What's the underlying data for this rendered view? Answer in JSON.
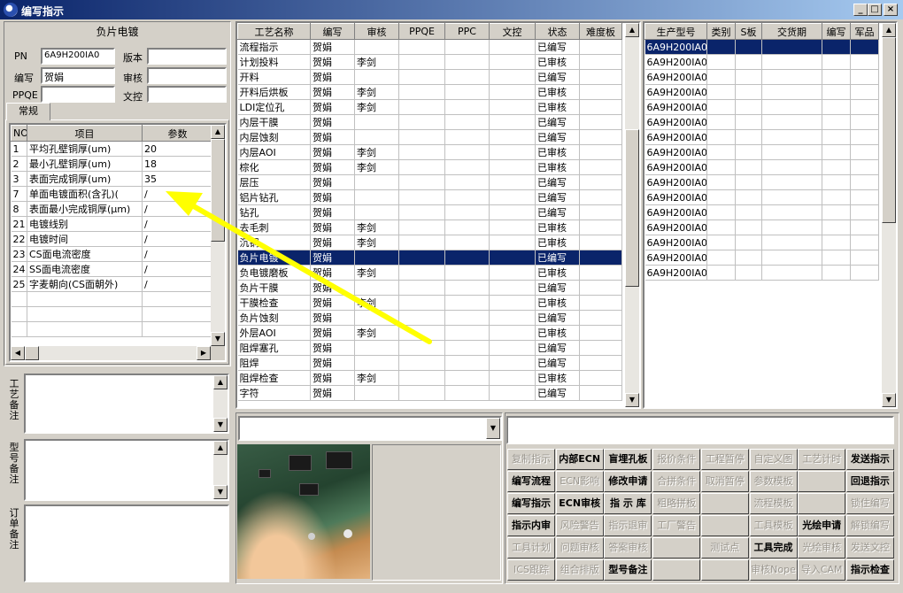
{
  "window": {
    "title": "编写指示",
    "min": "_",
    "max": "□",
    "close": "×"
  },
  "header_panel": {
    "title": "负片电镀",
    "pn_label": "PN",
    "pn_value": "6A9H200IA0",
    "version_label": "版本",
    "version_value": "",
    "writer_label": "编写",
    "writer_value": "贺娟",
    "audit_label": "审核",
    "audit_value": "",
    "ppqe_label": "PPQE",
    "ppqe_value": "",
    "doc_label": "文控",
    "doc_value": ""
  },
  "tabs": {
    "general": "常规"
  },
  "params_table": {
    "headers": [
      "NO",
      "项目",
      "参数"
    ],
    "rows": [
      [
        "1",
        "平均孔壁铜厚(um)",
        "20"
      ],
      [
        "2",
        "最小孔壁铜厚(um)",
        "18"
      ],
      [
        "3",
        "表面完成铜厚(um)",
        "35"
      ],
      [
        "7",
        "单面电镀面积(含孔)(",
        "/"
      ],
      [
        "8",
        "表面最小完成铜厚(μm)",
        "/"
      ],
      [
        "21",
        "电镀线别",
        "/"
      ],
      [
        "22",
        "电镀时间",
        "/"
      ],
      [
        "23",
        "CS面电流密度",
        "/"
      ],
      [
        "24",
        "SS面电流密度",
        "/"
      ],
      [
        "25",
        "字麦朝向(CS面朝外)",
        "/"
      ]
    ]
  },
  "notes": {
    "process_label": "工艺备注",
    "model_label": "型号备注",
    "order_label": "订单备注"
  },
  "process_table": {
    "headers": [
      "工艺名称",
      "编写",
      "审核",
      "PPQE",
      "PPC",
      "文控",
      "状态",
      "难度板"
    ],
    "rows": [
      [
        "流程指示",
        "贺娟",
        "",
        "",
        "",
        "",
        "已编写",
        ""
      ],
      [
        "计划投料",
        "贺娟",
        "李剑",
        "",
        "",
        "",
        "已审核",
        ""
      ],
      [
        "开料",
        "贺娟",
        "",
        "",
        "",
        "",
        "已编写",
        ""
      ],
      [
        "开料后烘板",
        "贺娟",
        "李剑",
        "",
        "",
        "",
        "已审核",
        ""
      ],
      [
        "LDI定位孔",
        "贺娟",
        "李剑",
        "",
        "",
        "",
        "已审核",
        ""
      ],
      [
        "内层干膜",
        "贺娟",
        "",
        "",
        "",
        "",
        "已编写",
        ""
      ],
      [
        "内层蚀刻",
        "贺娟",
        "",
        "",
        "",
        "",
        "已编写",
        ""
      ],
      [
        "内层AOI",
        "贺娟",
        "李剑",
        "",
        "",
        "",
        "已审核",
        ""
      ],
      [
        "棕化",
        "贺娟",
        "李剑",
        "",
        "",
        "",
        "已审核",
        ""
      ],
      [
        "层压",
        "贺娟",
        "",
        "",
        "",
        "",
        "已编写",
        ""
      ],
      [
        "铝片钻孔",
        "贺娟",
        "",
        "",
        "",
        "",
        "已编写",
        ""
      ],
      [
        "钻孔",
        "贺娟",
        "",
        "",
        "",
        "",
        "已编写",
        ""
      ],
      [
        "去毛刺",
        "贺娟",
        "李剑",
        "",
        "",
        "",
        "已审核",
        ""
      ],
      [
        "沉铜",
        "贺娟",
        "李剑",
        "",
        "",
        "",
        "已审核",
        ""
      ],
      [
        "负片电镀",
        "贺娟",
        "",
        "",
        "",
        "",
        "已编写",
        ""
      ],
      [
        "负电镀磨板",
        "贺娟",
        "李剑",
        "",
        "",
        "",
        "已审核",
        ""
      ],
      [
        "负片干膜",
        "贺娟",
        "",
        "",
        "",
        "",
        "已编写",
        ""
      ],
      [
        "干膜检查",
        "贺娟",
        "李剑",
        "",
        "",
        "",
        "已审核",
        ""
      ],
      [
        "负片蚀刻",
        "贺娟",
        "",
        "",
        "",
        "",
        "已编写",
        ""
      ],
      [
        "外层AOI",
        "贺娟",
        "李剑",
        "",
        "",
        "",
        "已审核",
        ""
      ],
      [
        "阻焊塞孔",
        "贺娟",
        "",
        "",
        "",
        "",
        "已编写",
        ""
      ],
      [
        "阻焊",
        "贺娟",
        "",
        "",
        "",
        "",
        "已编写",
        ""
      ],
      [
        "阻焊检查",
        "贺娟",
        "李剑",
        "",
        "",
        "",
        "已审核",
        ""
      ],
      [
        "字符",
        "贺娟",
        "",
        "",
        "",
        "",
        "已编写",
        ""
      ]
    ],
    "selected_index": 14
  },
  "model_table": {
    "headers": [
      "生产型号",
      "类别",
      "S板",
      "交货期",
      "编写",
      "军品"
    ],
    "rows": [
      "6A9H200IA0",
      "6A9H200IA0",
      "6A9H200IA0",
      "6A9H200IA0",
      "6A9H200IA0",
      "6A9H200IA0",
      "6A9H200IA0",
      "6A9H200IA0",
      "6A9H200IA0",
      "6A9H200IA0",
      "6A9H200IA0",
      "6A9H200IA0",
      "6A9H200IA0",
      "6A9H200IA0",
      "6A9H200IA0",
      "6A9H200IA0"
    ],
    "selected_index": 0
  },
  "buttons": [
    [
      {
        "label": "复制指示",
        "enabled": false
      },
      {
        "label": "内部ECN",
        "enabled": true
      },
      {
        "label": "盲埋孔板",
        "enabled": true
      },
      {
        "label": "报价条件",
        "enabled": false
      },
      {
        "label": "工程暂停",
        "enabled": false
      },
      {
        "label": "自定义图",
        "enabled": false
      },
      {
        "label": "工艺计时",
        "enabled": false
      },
      {
        "label": "发送指示",
        "enabled": true
      }
    ],
    [
      {
        "label": "编写流程",
        "enabled": true
      },
      {
        "label": "ECN影响",
        "enabled": false
      },
      {
        "label": "修改申请",
        "enabled": true
      },
      {
        "label": "合拼条件",
        "enabled": false
      },
      {
        "label": "取消暂停",
        "enabled": false
      },
      {
        "label": "参数模板",
        "enabled": false
      },
      {
        "label": "",
        "enabled": false
      },
      {
        "label": "回退指示",
        "enabled": true
      }
    ],
    [
      {
        "label": "编写指示",
        "enabled": true
      },
      {
        "label": "ECN审核",
        "enabled": true
      },
      {
        "label": "指 示 库",
        "enabled": true
      },
      {
        "label": "粗略拼板",
        "enabled": false
      },
      {
        "label": "",
        "enabled": false
      },
      {
        "label": "流程模板",
        "enabled": false
      },
      {
        "label": "",
        "enabled": false
      },
      {
        "label": "锁住编写",
        "enabled": false
      }
    ],
    [
      {
        "label": "指示内审",
        "enabled": true
      },
      {
        "label": "风险警告",
        "enabled": false
      },
      {
        "label": "指示退审",
        "enabled": false
      },
      {
        "label": "工厂警告",
        "enabled": false
      },
      {
        "label": "",
        "enabled": false
      },
      {
        "label": "工具模板",
        "enabled": false
      },
      {
        "label": "光绘申请",
        "enabled": true
      },
      {
        "label": "解锁编写",
        "enabled": false
      }
    ],
    [
      {
        "label": "工具计划",
        "enabled": false
      },
      {
        "label": "问题审核",
        "enabled": false
      },
      {
        "label": "答案审核",
        "enabled": false
      },
      {
        "label": "",
        "enabled": false
      },
      {
        "label": "测试点",
        "enabled": false
      },
      {
        "label": "工具完成",
        "enabled": true
      },
      {
        "label": "光绘审核",
        "enabled": false
      },
      {
        "label": "发送文控",
        "enabled": false
      }
    ],
    [
      {
        "label": "ICS跟踪",
        "enabled": false
      },
      {
        "label": "组合排版",
        "enabled": false
      },
      {
        "label": "型号备注",
        "enabled": true
      },
      {
        "label": "",
        "enabled": false
      },
      {
        "label": "",
        "enabled": false
      },
      {
        "label": "审核Nope",
        "enabled": false
      },
      {
        "label": "导入CAM",
        "enabled": false
      },
      {
        "label": "指示检查",
        "enabled": true
      }
    ]
  ],
  "colors": {
    "titlebar": "#0a246a",
    "selection": "#0a246a",
    "annotation_arrow": "#ffff00"
  },
  "icons": {
    "app": "app-logo-icon",
    "photo": "pcb-photo"
  }
}
